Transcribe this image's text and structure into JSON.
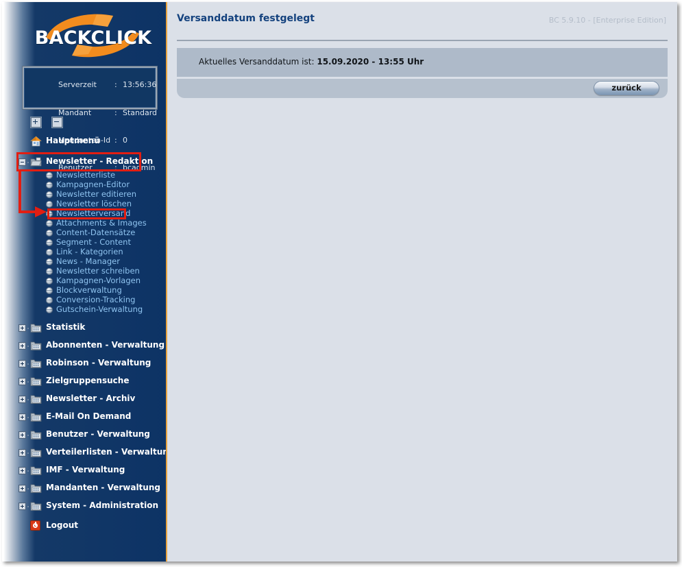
{
  "branding": {
    "logo_text": "BACKCLICK",
    "logo_icon": "swoosh-icon"
  },
  "server_info": {
    "rows": [
      {
        "label": "Serverzeit",
        "sep": ":",
        "value": "13:56:36"
      },
      {
        "label": "Mandant",
        "sep": ":",
        "value": "Standard"
      },
      {
        "label": "Mandanten-Id",
        "sep": ":",
        "value": "0"
      },
      {
        "label": "Benutzer",
        "sep": ":",
        "value": "bcadmin"
      }
    ]
  },
  "tree_tools": {
    "expand_all": "+",
    "collapse_all": "-"
  },
  "sidebar": {
    "home": {
      "label": "Hauptmenü",
      "icon": "house-icon"
    },
    "open_section": {
      "label": "Newsletter - Redaktion",
      "icon": "folder-open-icon",
      "twisty": "minus",
      "items": [
        {
          "label": "Newsletterliste",
          "icon": "globe-bullet-icon"
        },
        {
          "label": "Kampagnen-Editor",
          "icon": "globe-bullet-icon"
        },
        {
          "label": "Newsletter editieren",
          "icon": "globe-bullet-icon"
        },
        {
          "label": "Newsletter löschen",
          "icon": "globe-bullet-icon"
        },
        {
          "label": "Newsletterversand",
          "icon": "globe-bullet-icon"
        },
        {
          "label": "Attachments & Images",
          "icon": "globe-bullet-icon"
        },
        {
          "label": "Content-Datensätze",
          "icon": "globe-bullet-icon"
        },
        {
          "label": "Segment - Content",
          "icon": "globe-bullet-icon"
        },
        {
          "label": "Link - Kategorien",
          "icon": "globe-bullet-icon"
        },
        {
          "label": "News - Manager",
          "icon": "globe-bullet-icon"
        },
        {
          "label": "Newsletter schreiben",
          "icon": "globe-bullet-icon"
        },
        {
          "label": "Kampagnen-Vorlagen",
          "icon": "globe-bullet-icon"
        },
        {
          "label": "Blockverwaltung",
          "icon": "globe-bullet-icon"
        },
        {
          "label": "Conversion-Tracking",
          "icon": "globe-bullet-icon"
        },
        {
          "label": "Gutschein-Verwaltung",
          "icon": "globe-bullet-icon"
        }
      ]
    },
    "sections": [
      {
        "label": "Statistik",
        "icon": "folder-icon",
        "twisty": "plus"
      },
      {
        "label": "Abonnenten - Verwaltung",
        "icon": "folder-icon",
        "twisty": "plus"
      },
      {
        "label": "Robinson - Verwaltung",
        "icon": "folder-icon",
        "twisty": "plus"
      },
      {
        "label": "Zielgruppensuche",
        "icon": "folder-icon",
        "twisty": "plus"
      },
      {
        "label": "Newsletter - Archiv",
        "icon": "folder-icon",
        "twisty": "plus"
      },
      {
        "label": "E-Mail On Demand",
        "icon": "folder-icon",
        "twisty": "plus"
      },
      {
        "label": "Benutzer - Verwaltung",
        "icon": "folder-icon",
        "twisty": "plus"
      },
      {
        "label": "Verteilerlisten - Verwaltung",
        "icon": "folder-icon",
        "twisty": "plus"
      },
      {
        "label": "IMF - Verwaltung",
        "icon": "folder-icon",
        "twisty": "plus"
      },
      {
        "label": "Mandanten - Verwaltung",
        "icon": "folder-icon",
        "twisty": "plus"
      },
      {
        "label": "System - Administration",
        "icon": "folder-icon",
        "twisty": "plus"
      }
    ],
    "logout": {
      "label": "Logout",
      "icon": "power-icon"
    }
  },
  "main": {
    "title": "Versanddatum festgelegt",
    "version": "BC 5.9.10 - [Enterprise Edition]",
    "info_prefix": "Aktuelles Versanddatum ist:",
    "info_value": "15.09.2020 - 13:55 Uhr",
    "back_button": "zurück"
  },
  "annotation": {
    "color": "#e21e12",
    "highlighted_section": "Newsletter - Redaktion",
    "highlighted_item": "Newsletterversand",
    "arrow": "arrow-right-icon"
  },
  "colors": {
    "sidebar_dark": "#0d3365",
    "accent_orange": "#e8a33d",
    "title_blue": "#14427e",
    "link_blue": "#8fc4f0",
    "panel_bg": "#dbe0e8",
    "info_bar": "#aebac9"
  }
}
